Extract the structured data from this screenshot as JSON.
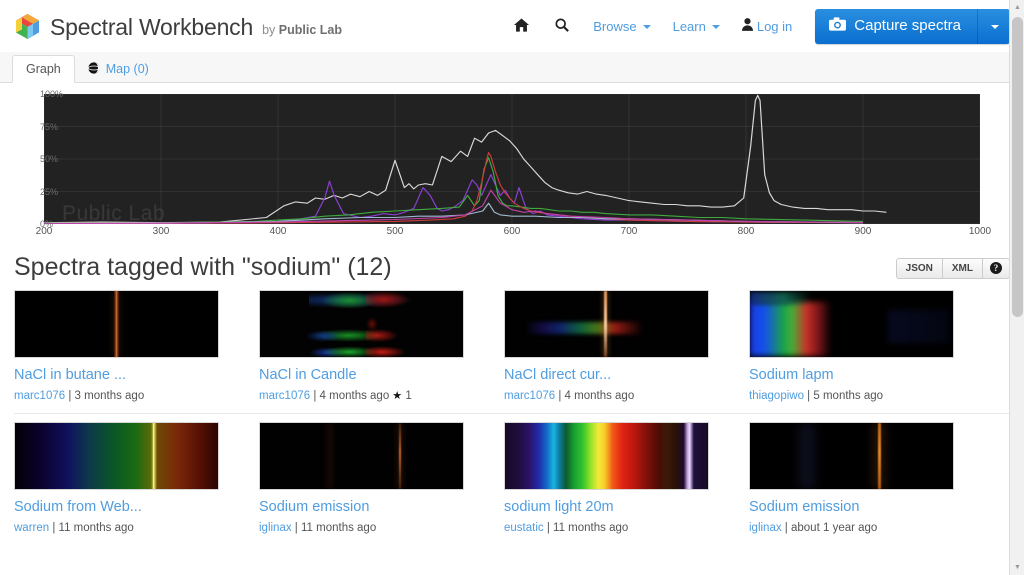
{
  "header": {
    "brand_title": "Spectral Workbench",
    "brand_by": "by",
    "brand_org": "Public Lab",
    "logo_icon": "cube-logo-icon",
    "nav": [
      {
        "label": "",
        "icon": "home-icon",
        "caret": false
      },
      {
        "label": "",
        "icon": "search-icon",
        "caret": false
      },
      {
        "label": "Browse",
        "icon": "",
        "caret": true
      },
      {
        "label": "Learn",
        "icon": "",
        "caret": true
      },
      {
        "label": "Log in",
        "icon": "user-icon",
        "caret": false
      }
    ],
    "capture_button": {
      "label": "Capture spectra",
      "icon": "camera-icon",
      "caret_icon": "caret-down-icon",
      "color": "#1a7fd4"
    }
  },
  "tabs": [
    {
      "label": "Graph",
      "icon": "",
      "active": true
    },
    {
      "label": "Map (0)",
      "icon": "globe-icon",
      "active": false
    }
  ],
  "chart_data": {
    "type": "line",
    "title": "",
    "xlabel": "",
    "ylabel": "",
    "xlim": [
      200,
      1000
    ],
    "ylim": [
      0,
      100
    ],
    "grid": true,
    "background": "#222222",
    "x_ticks": [
      200,
      300,
      400,
      500,
      600,
      700,
      800,
      900,
      1000
    ],
    "y_ticks": [
      "0%",
      "25%",
      "50%",
      "75%",
      "100%"
    ],
    "y_tick_values": [
      0,
      25,
      50,
      75,
      100
    ],
    "watermark": "Public Lab",
    "legend_position": "none",
    "series": [
      {
        "name": "white-trace",
        "color": "#d8d8d8",
        "x": [
          200,
          250,
          300,
          350,
          390,
          405,
          415,
          425,
          432,
          440,
          448,
          455,
          462,
          470,
          478,
          485,
          492,
          500,
          508,
          512,
          516,
          520,
          526,
          532,
          540,
          548,
          556,
          562,
          568,
          574,
          580,
          586,
          592,
          598,
          604,
          610,
          616,
          622,
          628,
          634,
          640,
          648,
          656,
          664,
          672,
          680,
          690,
          700,
          710,
          720,
          730,
          740,
          750,
          760,
          770,
          780,
          790,
          798,
          804,
          808,
          810,
          812,
          816,
          820,
          824,
          830,
          840,
          850,
          860,
          870,
          880,
          890,
          900,
          910,
          920
        ],
        "y": [
          1,
          1.5,
          1,
          1.5,
          5,
          14,
          17,
          16,
          20,
          19,
          22,
          20,
          23,
          21,
          25,
          22,
          26,
          49,
          28,
          31,
          27,
          30,
          31,
          30,
          52,
          48,
          56,
          52,
          66,
          63,
          70,
          72,
          68,
          64,
          58,
          50,
          44,
          38,
          32,
          28,
          26,
          24,
          23,
          25,
          23,
          22,
          20,
          18,
          17,
          16,
          15,
          15,
          14,
          14,
          13,
          13,
          14,
          20,
          60,
          95,
          99,
          95,
          38,
          24,
          18,
          15,
          13,
          12,
          12,
          11,
          11,
          11,
          10,
          10,
          9
        ]
      },
      {
        "name": "purple-trace",
        "color": "#8b3fd4",
        "x": [
          200,
          300,
          380,
          400,
          412,
          420,
          432,
          440,
          444,
          448,
          456,
          470,
          480,
          490,
          500,
          508,
          516,
          524,
          530,
          536,
          540,
          546,
          552,
          558,
          562,
          566,
          570,
          574,
          578,
          582,
          586,
          590,
          594,
          598,
          602,
          606,
          612,
          618,
          624,
          630,
          640,
          650,
          660,
          680,
          700,
          750,
          800,
          900
        ],
        "y": [
          0.5,
          0.5,
          1,
          2,
          3,
          4,
          6,
          20,
          33,
          22,
          8,
          5,
          6,
          8,
          7,
          9,
          12,
          28,
          22,
          12,
          10,
          11,
          14,
          18,
          26,
          34,
          30,
          22,
          30,
          38,
          30,
          22,
          26,
          20,
          16,
          28,
          12,
          8,
          10,
          7,
          6,
          5,
          4,
          3,
          3,
          2,
          1.5,
          1
        ]
      },
      {
        "name": "green-trace",
        "color": "#3faa3f",
        "x": [
          200,
          300,
          380,
          400,
          420,
          440,
          460,
          480,
          500,
          520,
          540,
          555,
          562,
          568,
          572,
          576,
          580,
          584,
          588,
          592,
          596,
          600,
          608,
          616,
          624,
          632,
          640,
          650,
          660,
          670,
          680,
          700,
          720,
          740,
          760,
          780,
          800,
          850,
          900
        ],
        "y": [
          0.5,
          0.8,
          2,
          3,
          4,
          6,
          7,
          9,
          10,
          11,
          12,
          13,
          22,
          14,
          18,
          42,
          51,
          40,
          22,
          16,
          14,
          14,
          13,
          12,
          12,
          11,
          10,
          10,
          9,
          9,
          8,
          7,
          7,
          6,
          5,
          5,
          4,
          3,
          2
        ]
      },
      {
        "name": "red-trace",
        "color": "#cc3b3b",
        "x": [
          200,
          300,
          400,
          450,
          500,
          530,
          550,
          560,
          566,
          570,
          574,
          578,
          580,
          582,
          586,
          590,
          594,
          598,
          602,
          606,
          610,
          616,
          622,
          630,
          640,
          650,
          660,
          680,
          700,
          750,
          800,
          900
        ],
        "y": [
          0.3,
          0.5,
          1,
          1.5,
          2,
          3,
          4,
          6,
          10,
          18,
          32,
          48,
          55,
          52,
          40,
          30,
          24,
          20,
          16,
          14,
          12,
          10,
          9,
          8,
          7,
          6,
          5,
          4,
          3,
          2,
          1.5,
          1
        ]
      },
      {
        "name": "lightblue-trace",
        "color": "#9fb8d0",
        "x": [
          200,
          300,
          400,
          440,
          470,
          500,
          520,
          540,
          560,
          575,
          580,
          585,
          590,
          600,
          620,
          640,
          660,
          680,
          700,
          750,
          800,
          900
        ],
        "y": [
          0.3,
          0.5,
          2,
          4,
          5,
          5,
          6,
          6,
          7,
          10,
          16,
          9,
          7,
          6,
          6,
          5,
          5,
          4,
          4,
          3,
          2,
          1
        ]
      },
      {
        "name": "magenta-trace",
        "color": "#c040a8",
        "x": [
          200,
          300,
          400,
          450,
          500,
          540,
          560,
          575,
          582,
          590,
          600,
          610,
          620,
          630,
          650,
          680,
          700,
          750,
          800,
          900
        ],
        "y": [
          0.4,
          0.6,
          1.5,
          2.5,
          3.5,
          5,
          7,
          14,
          26,
          16,
          11,
          9,
          10,
          8,
          6,
          5,
          4,
          3,
          2,
          1.2
        ]
      }
    ]
  },
  "section": {
    "title": "Spectra tagged with \"sodium\" (12)",
    "format_buttons": [
      {
        "label": "JSON"
      },
      {
        "label": "XML"
      }
    ],
    "help_button": {
      "label": "?",
      "icon": "help-icon"
    }
  },
  "spectra": [
    {
      "title": "NaCl in butane ...",
      "author": "marc1076",
      "time": "3 months ago",
      "separator": "|",
      "stars": null,
      "star_icon": "",
      "thumb": "nacl-butane-thumb"
    },
    {
      "title": "NaCl in Candle",
      "author": "marc1076",
      "time": "4 months ago",
      "separator": "|",
      "stars": "1",
      "star_icon": "star-icon",
      "thumb": "nacl-candle-thumb"
    },
    {
      "title": "NaCl direct cur...",
      "author": "marc1076",
      "time": "4 months ago",
      "separator": "|",
      "stars": null,
      "star_icon": "",
      "thumb": "nacl-direct-thumb"
    },
    {
      "title": "Sodium lapm",
      "author": "thiagopiwo",
      "time": "5 months ago",
      "separator": "|",
      "stars": null,
      "star_icon": "",
      "thumb": "sodium-lapm-thumb"
    },
    {
      "title": "Sodium from Web...",
      "author": "warren",
      "time": "11 months ago",
      "separator": "|",
      "stars": null,
      "star_icon": "",
      "thumb": "sodium-web-thumb"
    },
    {
      "title": "Sodium emission",
      "author": "iglinax",
      "time": "11 months ago",
      "separator": "|",
      "stars": null,
      "star_icon": "",
      "thumb": "sodium-emission-1-thumb"
    },
    {
      "title": "sodium light 20m",
      "author": "eustatic",
      "time": "11 months ago",
      "separator": "|",
      "stars": null,
      "star_icon": "",
      "thumb": "sodium-light-20m-thumb"
    },
    {
      "title": "Sodium emission",
      "author": "iglinax",
      "time": "about 1 year ago",
      "separator": "|",
      "stars": null,
      "star_icon": "",
      "thumb": "sodium-emission-2-thumb"
    }
  ],
  "scrollbar": {
    "up_icon": "caret-up-icon",
    "down_icon": "caret-down-icon"
  }
}
